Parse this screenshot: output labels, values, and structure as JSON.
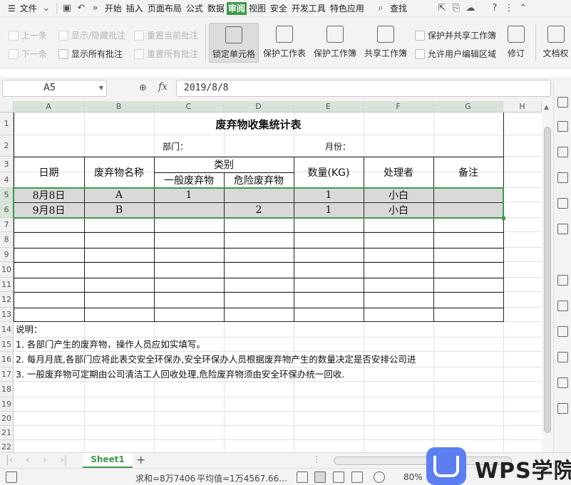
{
  "menubar": {
    "file": "文件",
    "tabs": [
      "开始",
      "插入",
      "页面布局",
      "公式",
      "数据",
      "审阅",
      "视图",
      "安全",
      "开发工具",
      "特色应用"
    ],
    "active_tab": "审阅",
    "search": "查找"
  },
  "ribbon": {
    "prev_comment": "上一条",
    "next_comment": "下一条",
    "show_hide_comment": "显示/隐藏批注",
    "show_all_comments": "显示所有批注",
    "reset_current_comment": "重置当前批注",
    "reset_all_comments": "重置所有批注",
    "lock_cell": "锁定单元格",
    "protect_sheet": "保护工作表",
    "protect_workbook": "保护工作簿",
    "share_workbook": "共享工作簿",
    "protect_and_share": "保护并共享工作簿",
    "allow_edit_ranges": "允许用户编辑区域",
    "revisions": "修订",
    "document_rights": "文档权"
  },
  "formula_bar": {
    "name_box": "A5",
    "fx": "fx",
    "value": "2019/8/8"
  },
  "sheet": {
    "columns": [
      "A",
      "B",
      "C",
      "D",
      "E",
      "F",
      "G",
      "H"
    ],
    "rows": [
      "1",
      "2",
      "3",
      "4",
      "5",
      "6",
      "7",
      "8",
      "9",
      "10",
      "11",
      "12",
      "13",
      "14",
      "15",
      "16",
      "17",
      "18",
      "19",
      "20",
      "21",
      "22"
    ],
    "title": "废弃物收集统计表",
    "dept_label": "部门：",
    "month_label": "月份：",
    "headers": {
      "date": "日期",
      "name": "废弃物名称",
      "category": "类别",
      "general": "一般废弃物",
      "hazard": "危险废弃物",
      "qty": "数量(KG)",
      "handler": "处理者",
      "remark": "备注"
    },
    "records": [
      {
        "date": "8月8日",
        "name": "A",
        "general": "1",
        "hazard": "",
        "qty": "1",
        "handler": "小白",
        "remark": ""
      },
      {
        "date": "9月8日",
        "name": "B",
        "general": "",
        "hazard": "2",
        "qty": "1",
        "handler": "小白",
        "remark": ""
      }
    ],
    "notes": [
      "说明：",
      "1.      各部门产生的废弃物，操作人员应如实填写。",
      "2.      每月月底,各部门应将此表交安全环保办,安全环保办人员根据废弃物产生的数量决定是否安排公司进",
      "3.      一般废弃物可定期由公司清洁工人回收处理,危险废弃物须由安全环保办统一回收."
    ]
  },
  "sheet_tabs": {
    "active": "Sheet1",
    "add": "+"
  },
  "statusbar": {
    "sum": "求和=8万7406",
    "average": "平均值=1万4567.66...",
    "zoom": "80%"
  },
  "watermark": {
    "text": "WPS学院"
  }
}
